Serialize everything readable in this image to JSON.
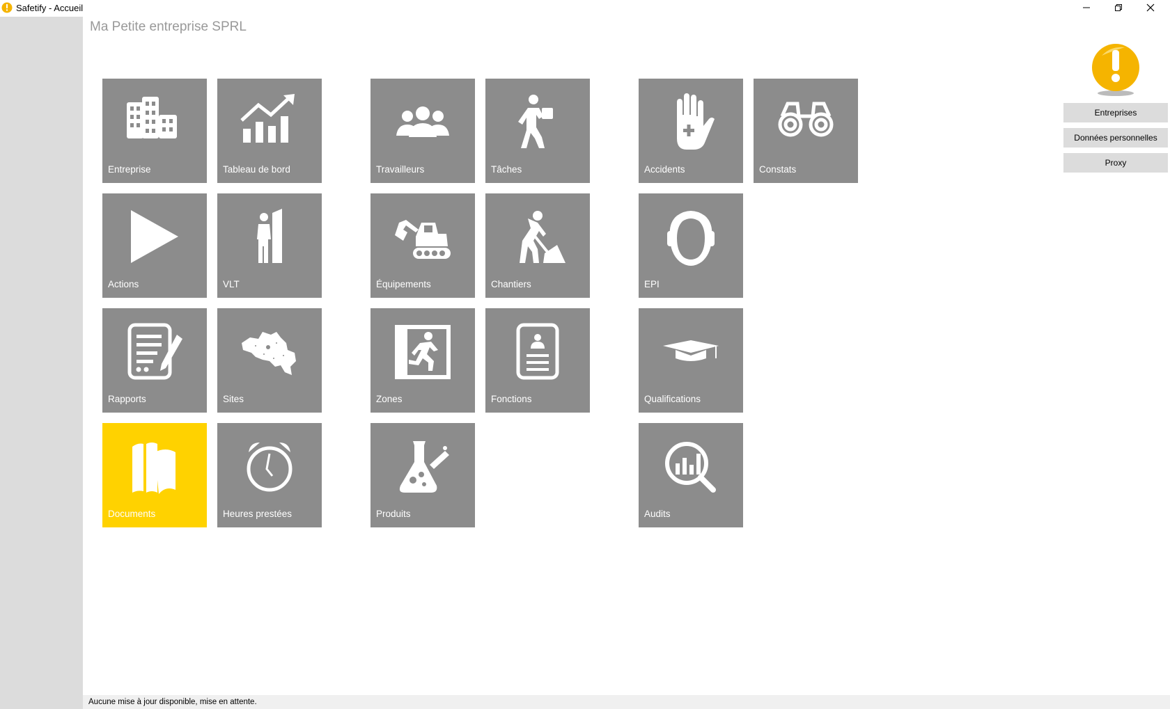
{
  "window": {
    "title": "Safetify - Accueil"
  },
  "header": {
    "company": "Ma Petite entreprise SPRL"
  },
  "tiles": [
    {
      "label": "Entreprise",
      "icon": "building-icon"
    },
    {
      "label": "Tableau de bord",
      "icon": "chart-growth-icon"
    },
    {
      "label": "Travailleurs",
      "icon": "group-icon"
    },
    {
      "label": "Tâches",
      "icon": "worker-carrying-icon"
    },
    {
      "label": "Accidents",
      "icon": "hand-plus-icon"
    },
    {
      "label": "Constats",
      "icon": "binoculars-icon"
    },
    {
      "label": "Actions",
      "icon": "play-icon"
    },
    {
      "label": "VLT",
      "icon": "person-door-icon"
    },
    {
      "label": "Équipements",
      "icon": "excavator-icon"
    },
    {
      "label": "Chantiers",
      "icon": "worker-shovel-icon"
    },
    {
      "label": "EPI",
      "icon": "ear-protection-icon"
    },
    {
      "label": "Rapports",
      "icon": "report-pen-icon"
    },
    {
      "label": "Sites",
      "icon": "map-belgium-icon"
    },
    {
      "label": "Zones",
      "icon": "emergency-exit-icon"
    },
    {
      "label": "Fonctions",
      "icon": "id-badge-icon"
    },
    {
      "label": "Qualifications",
      "icon": "graduation-cap-icon"
    },
    {
      "label": "Documents",
      "icon": "books-icon",
      "active": true
    },
    {
      "label": "Heures prestées",
      "icon": "alarm-clock-icon"
    },
    {
      "label": "Produits",
      "icon": "flask-icon"
    },
    {
      "label": "Audits",
      "icon": "magnifier-chart-icon"
    }
  ],
  "side_buttons": {
    "entreprises": "Entreprises",
    "donnees": "Données personnelles",
    "proxy": "Proxy"
  },
  "status": {
    "text": "Aucune mise à jour disponible, mise en attente."
  },
  "colors": {
    "tile": "#8c8c8c",
    "tile_active": "#ffd200",
    "sidebar": "#dcdcdc",
    "alert": "#f5b400"
  }
}
